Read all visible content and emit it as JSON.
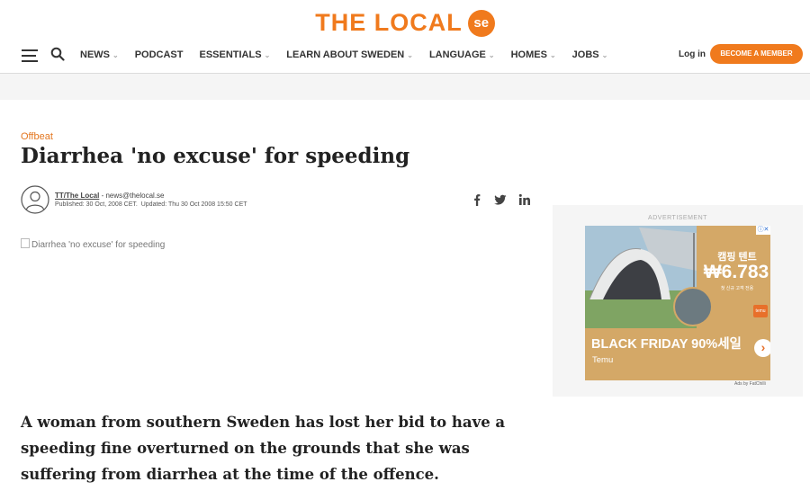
{
  "header": {
    "logo_text": "THE LOCAL",
    "logo_badge": "se"
  },
  "nav": {
    "items": [
      {
        "label": "NEWS",
        "has_dropdown": true
      },
      {
        "label": "PODCAST",
        "has_dropdown": false
      },
      {
        "label": "ESSENTIALS",
        "has_dropdown": true
      },
      {
        "label": "LEARN ABOUT SWEDEN",
        "has_dropdown": true
      },
      {
        "label": "LANGUAGE",
        "has_dropdown": true
      },
      {
        "label": "HOMES",
        "has_dropdown": true
      },
      {
        "label": "JOBS",
        "has_dropdown": true
      }
    ],
    "login_label": "Log in",
    "member_label": "BECOME A MEMBER"
  },
  "article": {
    "category": "Offbeat",
    "title": "Diarrhea 'no excuse' for speeding",
    "author": "TT/The Local",
    "author_email": "news@thelocal.se",
    "published": "Published: 30 Oct, 2008 CET.",
    "updated": "Updated: Thu 30 Oct 2008 15:50 CET",
    "image_alt": "Diarrhea 'no excuse' for speeding",
    "lead": "A woman from southern Sweden has lost her bid to have a speeding fine overturned on the grounds that she was suffering from diarrhea at the time of the offence."
  },
  "share": {
    "icons": [
      "facebook-icon",
      "twitter-icon",
      "linkedin-icon"
    ]
  },
  "ad": {
    "label": "ADVERTISEMENT",
    "korean_headline": "캠핑 텐트",
    "price": "₩6.783",
    "small_text": "첫 신규 고객 전용",
    "promo": "BLACK FRIDAY 90%세일",
    "brand": "Temu",
    "ads_by": "Ads by FatChilli"
  },
  "colors": {
    "brand_orange": "#f07a1d",
    "ad_background": "#d4a867"
  }
}
